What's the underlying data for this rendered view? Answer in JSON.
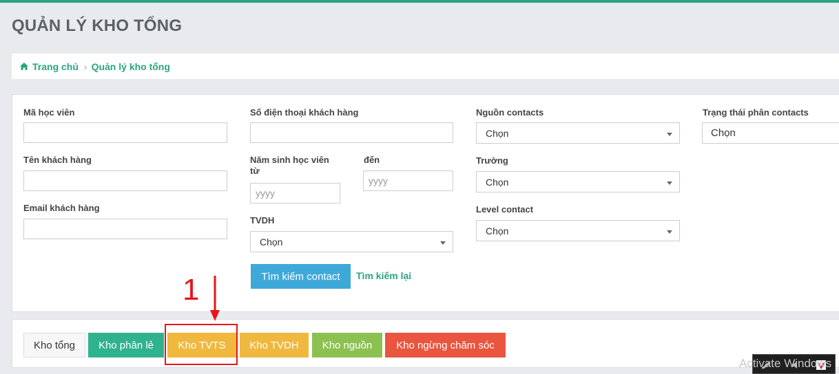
{
  "page": {
    "title": "QUẢN LÝ KHO TỔNG"
  },
  "breadcrumb": {
    "home": "Trang chủ",
    "current": "Quản lý kho tổng"
  },
  "filters": {
    "ma_hoc_vien": {
      "label": "Mã học viên",
      "value": ""
    },
    "ten_khach_hang": {
      "label": "Tên khách hàng",
      "value": ""
    },
    "email_khach_hang": {
      "label": "Email khách hàng",
      "value": ""
    },
    "so_dien_thoai": {
      "label": "Số điện thoại khách hàng",
      "value": ""
    },
    "nam_sinh_tu": {
      "label": "Năm sinh học viên từ",
      "placeholder": "yyyy"
    },
    "nam_sinh_den": {
      "label": "đến",
      "placeholder": "yyyy"
    },
    "tvdh": {
      "label": "TVDH",
      "selected": "Chọn"
    },
    "nguon_contacts": {
      "label": "Nguồn contacts",
      "selected": "Chọn"
    },
    "truong": {
      "label": "Trường",
      "selected": "Chọn"
    },
    "level_contact": {
      "label": "Level contact",
      "selected": "Chọn"
    },
    "trang_thai": {
      "label": "Trạng thái phân contacts",
      "selected": "Chọn"
    }
  },
  "actions": {
    "search": "Tìm kiếm contact",
    "reset": "Tìm kiếm lại"
  },
  "tabs": [
    {
      "label": "Kho tổng",
      "color": "#f7f7f7"
    },
    {
      "label": "Kho phân lẻ",
      "color": "#2fb38f"
    },
    {
      "label": "Kho TVTS",
      "color": "#f0b83e"
    },
    {
      "label": "Kho TVDH",
      "color": "#f0b83e"
    },
    {
      "label": "Kho nguồn",
      "color": "#8cc152"
    },
    {
      "label": "Kho ngừng chăm sóc",
      "color": "#e9553e"
    }
  ],
  "annotation": {
    "number": "1",
    "color": "#e8141b"
  },
  "watermark": "Activate Windows",
  "colors": {
    "accent": "#2aa57f",
    "search_button": "#3ea9d9"
  }
}
